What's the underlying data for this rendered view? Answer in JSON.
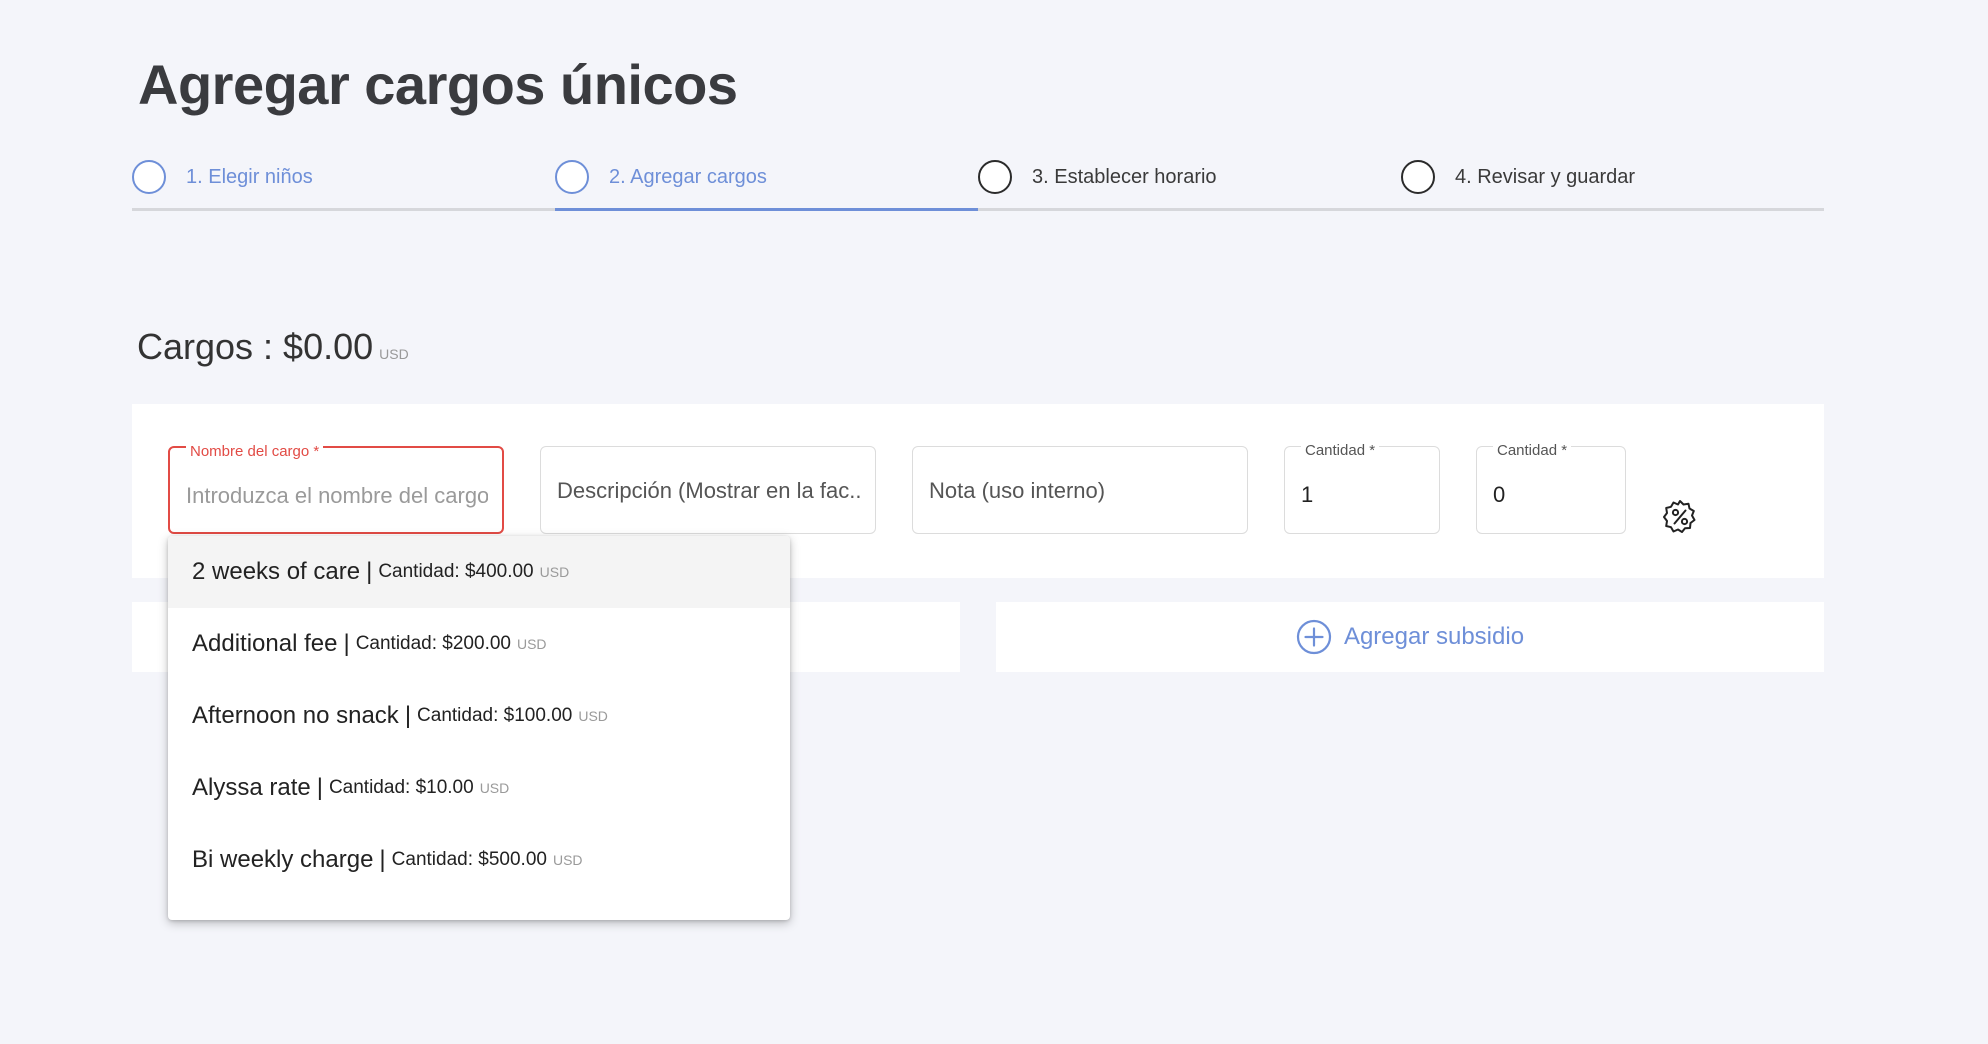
{
  "page": {
    "title": "Agregar cargos únicos"
  },
  "stepper": {
    "steps": [
      {
        "label": "1. Elegir niños",
        "state": "done"
      },
      {
        "label": "2. Agregar cargos",
        "state": "active"
      },
      {
        "label": "3. Establecer horario",
        "state": "pending"
      },
      {
        "label": "4. Revisar y guardar",
        "state": "pending"
      }
    ]
  },
  "total": {
    "label": "Cargos : $0.00",
    "currency": "USD"
  },
  "form": {
    "charge_name": {
      "label": "Nombre del cargo",
      "required_mark": "*",
      "placeholder": "Introduzca el nombre del cargo",
      "value": ""
    },
    "description": {
      "placeholder": "Descripción (Mostrar en la fac...",
      "value": ""
    },
    "note": {
      "placeholder": "Nota (uso interno)",
      "value": ""
    },
    "quantity": {
      "label": "Cantidad",
      "required_mark": "*",
      "value": "1"
    },
    "amount": {
      "label": "Cantidad",
      "required_mark": "*",
      "value": "0"
    },
    "discount_icon": "percent-badge-icon"
  },
  "subsidy": {
    "label": "Agregar subsidio",
    "icon": "plus-circle-icon"
  },
  "dropdown": {
    "items": [
      {
        "name": "2 weeks of care",
        "amount": "Cantidad: $400.00",
        "currency": "USD"
      },
      {
        "name": "Additional fee",
        "amount": "Cantidad: $200.00",
        "currency": "USD"
      },
      {
        "name": "Afternoon no snack",
        "amount": "Cantidad: $100.00",
        "currency": "USD"
      },
      {
        "name": "Alyssa rate",
        "amount": "Cantidad: $10.00",
        "currency": "USD"
      },
      {
        "name": "Bi weekly charge",
        "amount": "Cantidad: $500.00",
        "currency": "USD"
      }
    ],
    "separator": "|"
  },
  "colors": {
    "accent": "#6e8fd8",
    "error": "#e24b45",
    "background": "#f4f5fa"
  }
}
